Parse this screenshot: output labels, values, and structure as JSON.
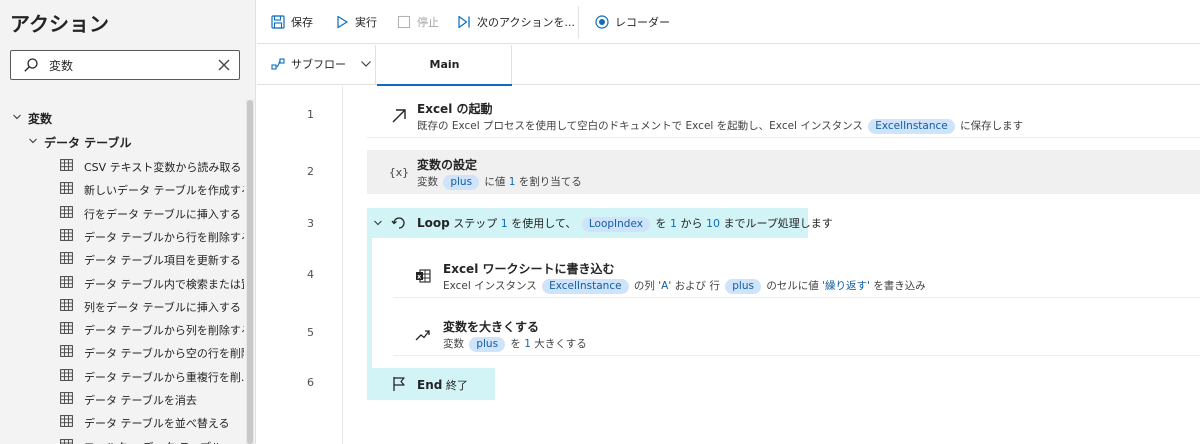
{
  "actions_pane": {
    "title": "アクション",
    "search": {
      "value": "変数",
      "placeholder": ""
    },
    "tree": {
      "category": "変数",
      "subcategory": "データ テーブル",
      "items": [
        "CSV テキスト変数から読み取る",
        "新しいデータ テーブルを作成する",
        "行をデータ テーブルに挿入する",
        "データ テーブルから行を削除する",
        "データ テーブル項目を更新する",
        "データ テーブル内で検索または置...",
        "列をデータ テーブルに挿入する",
        "データ テーブルから列を削除する",
        "データ テーブルから空の行を削除...",
        "データ テーブルから重複行を削...",
        "データ テーブルを消去",
        "データ テーブルを並べ替える",
        "フィルター データ テーブル"
      ]
    }
  },
  "toolbar": {
    "save": "保存",
    "run": "実行",
    "stop": "停止",
    "next_action": "次のアクションを...",
    "recorder": "レコーダー"
  },
  "tabs": {
    "subflow": "サブフロー",
    "main": "Main"
  },
  "flow": {
    "line_numbers": [
      "1",
      "2",
      "3",
      "4",
      "5",
      "6"
    ],
    "step1": {
      "title": "Excel の起動",
      "desc_a": "既存の Excel プロセスを使用して空白のドキュメントで Excel を起動し、Excel インスタンス",
      "var": "ExcelInstance",
      "desc_b": "に保存します"
    },
    "step2": {
      "title": "変数の設定",
      "desc_a": "変数",
      "var": "plus",
      "desc_b": "に値",
      "value": "1",
      "desc_c": "を割り当てる"
    },
    "step3": {
      "keyword": "Loop",
      "desc_a": "ステップ",
      "step_value": "1",
      "desc_b": "を使用して、",
      "var": "LoopIndex",
      "desc_c": "を",
      "from_value": "1",
      "desc_d": "から",
      "to_value": "10",
      "desc_e": "までループ処理します"
    },
    "step4": {
      "title": "Excel ワークシートに書き込む",
      "desc_a": "Excel インスタンス",
      "var": "ExcelInstance",
      "desc_b": "の列",
      "col_value": "'A'",
      "desc_c": "および 行",
      "row_var": "plus",
      "desc_d": "のセルに値",
      "write_value": "'繰り返す'",
      "desc_e": "を書き込み"
    },
    "step5": {
      "title": "変数を大きくする",
      "desc_a": "変数",
      "var": "plus",
      "desc_b": "を",
      "value": "1",
      "desc_c": "大きくする"
    },
    "step6": {
      "keyword": "End",
      "label": "終了"
    }
  },
  "colors": {
    "accent": "#0f6cbd",
    "variable_pill": "#cfe4fa",
    "loop_highlight": "#d2f4f7",
    "selected_step": "#f0f0f0"
  },
  "icons": {
    "save": "save-icon",
    "run": "play-icon",
    "stop": "stop-icon",
    "next": "step-next-icon",
    "recorder": "record-icon",
    "subflow": "subflow-icon",
    "step1": "arrow-up-right-icon",
    "step2": "variable-braces-icon",
    "step3": "loop-icon",
    "step4": "excel-write-icon",
    "step5": "trend-up-icon",
    "step6": "flag-icon",
    "table": "table-icon"
  }
}
